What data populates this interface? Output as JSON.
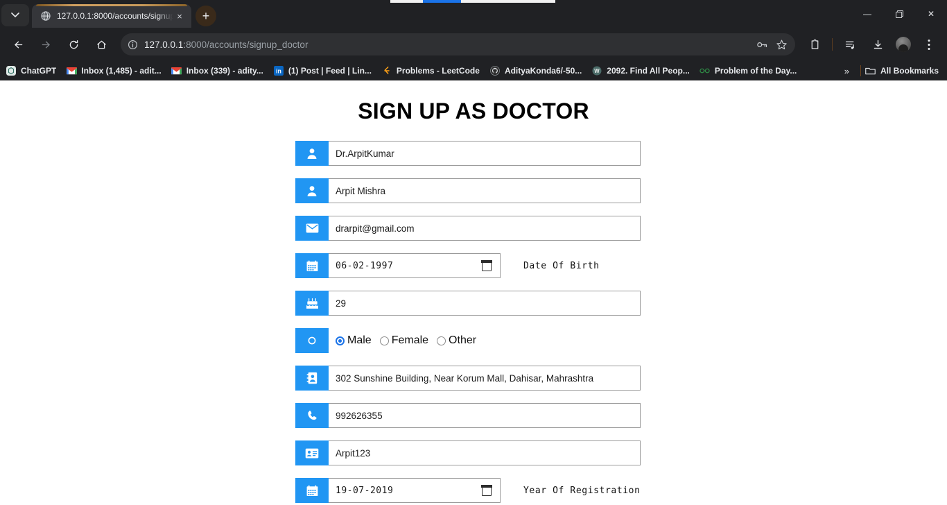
{
  "browser": {
    "tab": {
      "title": "127.0.0.1:8000/accounts/signup",
      "favicon": "globe-icon",
      "close_label": "×"
    },
    "new_tab_label": "+",
    "tabstrip_menu_label": "⌄",
    "window_controls": {
      "minimize": "—",
      "maximize": "❐",
      "close": "✕"
    },
    "toolbar": {
      "back": "←",
      "forward": "→",
      "reload": "⟳",
      "home": "⌂",
      "site_info": "site-information-icon",
      "url_host": "127.0.0.1",
      "url_path": ":8000/accounts/signup_doctor",
      "password_icon": "key-icon",
      "bookmark_icon": "star-icon",
      "extensions_icon": "extensions-puzzle-icon",
      "media_icon": "media-list-icon",
      "downloads_icon": "download-icon",
      "profile_icon": "profile-avatar",
      "menu_icon": "three-dot-menu-icon"
    },
    "bookmarks": [
      {
        "label": "ChatGPT",
        "icon": "chatgpt-icon",
        "icon_color": "#74aa9c"
      },
      {
        "label": "Inbox (1,485) - adit...",
        "icon": "gmail-icon",
        "icon_color": "#ea4335"
      },
      {
        "label": "Inbox (339) - adity...",
        "icon": "gmail-icon",
        "icon_color": "#ea4335"
      },
      {
        "label": "(1) Post | Feed | Lin...",
        "icon": "linkedin-icon",
        "icon_color": "#0a66c2"
      },
      {
        "label": "Problems - LeetCode",
        "icon": "leetcode-icon",
        "icon_color": "#ffa116"
      },
      {
        "label": "AdityaKonda6/-50...",
        "icon": "github-icon",
        "icon_color": "#c9ccd1"
      },
      {
        "label": "2092. Find All Peop...",
        "icon": "w-circle-icon",
        "icon_color": "#4b6b68"
      },
      {
        "label": "Problem of the Day...",
        "icon": "gfg-icon",
        "icon_color": "#2f8d46"
      }
    ],
    "bookmarks_overflow_label": "»",
    "all_bookmarks_label": "All Bookmarks",
    "all_bookmarks_icon": "folder-icon"
  },
  "page": {
    "title": "SIGN UP AS DOCTOR",
    "accent_color": "#2196f3",
    "fields": [
      {
        "name": "username",
        "icon": "user-icon",
        "value": "Dr.ArpitKumar",
        "type": "text"
      },
      {
        "name": "full-name",
        "icon": "user-icon",
        "value": "Arpit Mishra",
        "type": "text"
      },
      {
        "name": "email",
        "icon": "envelope-icon",
        "value": "drarpit@gmail.com",
        "type": "email"
      },
      {
        "name": "date-of-birth",
        "icon": "calendar-icon",
        "value": "06-02-1997",
        "type": "date",
        "side_label": "Date Of Birth"
      },
      {
        "name": "age",
        "icon": "birthday-cake-icon",
        "value": "29",
        "type": "number"
      },
      {
        "name": "gender",
        "icon": "gender-circle-icon",
        "type": "radio",
        "options": [
          {
            "label": "Male",
            "selected": true
          },
          {
            "label": "Female",
            "selected": false
          },
          {
            "label": "Other",
            "selected": false
          }
        ]
      },
      {
        "name": "address",
        "icon": "address-book-icon",
        "value": "302 Sunshine Building, Near Korum Mall, Dahisar, Mahrashtra",
        "type": "text"
      },
      {
        "name": "phone",
        "icon": "phone-icon",
        "value": "992626355",
        "type": "tel"
      },
      {
        "name": "license-id",
        "icon": "id-card-icon",
        "value": "Arpit123",
        "type": "text"
      },
      {
        "name": "year-of-registration",
        "icon": "calendar-icon",
        "value": "19-07-2019",
        "type": "date",
        "side_label": "Year Of Registration"
      }
    ]
  }
}
